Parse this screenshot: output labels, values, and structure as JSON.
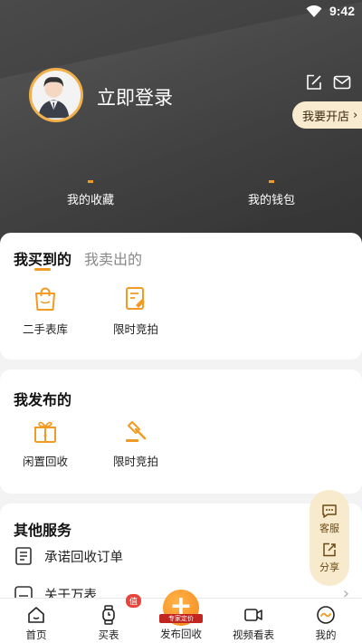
{
  "status_bar": {
    "time": "9:42"
  },
  "profile": {
    "login_text": "立即登录",
    "open_shop": "我要开店"
  },
  "stats": [
    {
      "label": "我的收藏"
    },
    {
      "label": "我的钱包"
    }
  ],
  "bought": {
    "tabs": [
      {
        "label": "我买到的"
      },
      {
        "label": "我卖出的"
      }
    ],
    "items": [
      {
        "label": "二手表库",
        "icon": "shopping-bag-icon"
      },
      {
        "label": "限时竞拍",
        "icon": "auction-doc-icon"
      }
    ]
  },
  "published": {
    "title": "我发布的",
    "items": [
      {
        "label": "闲置回收",
        "icon": "gift-box-icon"
      },
      {
        "label": "限时竞拍",
        "icon": "gavel-icon"
      }
    ]
  },
  "other_services": {
    "title": "其他服务",
    "items": [
      {
        "label": "承诺回收订单",
        "icon": "order-doc-icon"
      },
      {
        "label": "关于万表",
        "icon": "about-icon"
      }
    ]
  },
  "float_panel": {
    "service": "客服",
    "share": "分享"
  },
  "tabbar": {
    "items": [
      {
        "label": "首页",
        "icon": "home-icon"
      },
      {
        "label": "买表",
        "icon": "watch-icon",
        "badge": "值"
      },
      {
        "label": "发布回收",
        "icon": "plus-icon",
        "tag": "专家定价"
      },
      {
        "label": "视频看表",
        "icon": "video-icon"
      },
      {
        "label": "我的",
        "icon": "mine-icon"
      }
    ]
  },
  "colors": {
    "accent": "#f29a22",
    "header_bg": "#3d3d3d",
    "open_shop_bg": "#f8ebd0",
    "badge": "#e8453c"
  }
}
